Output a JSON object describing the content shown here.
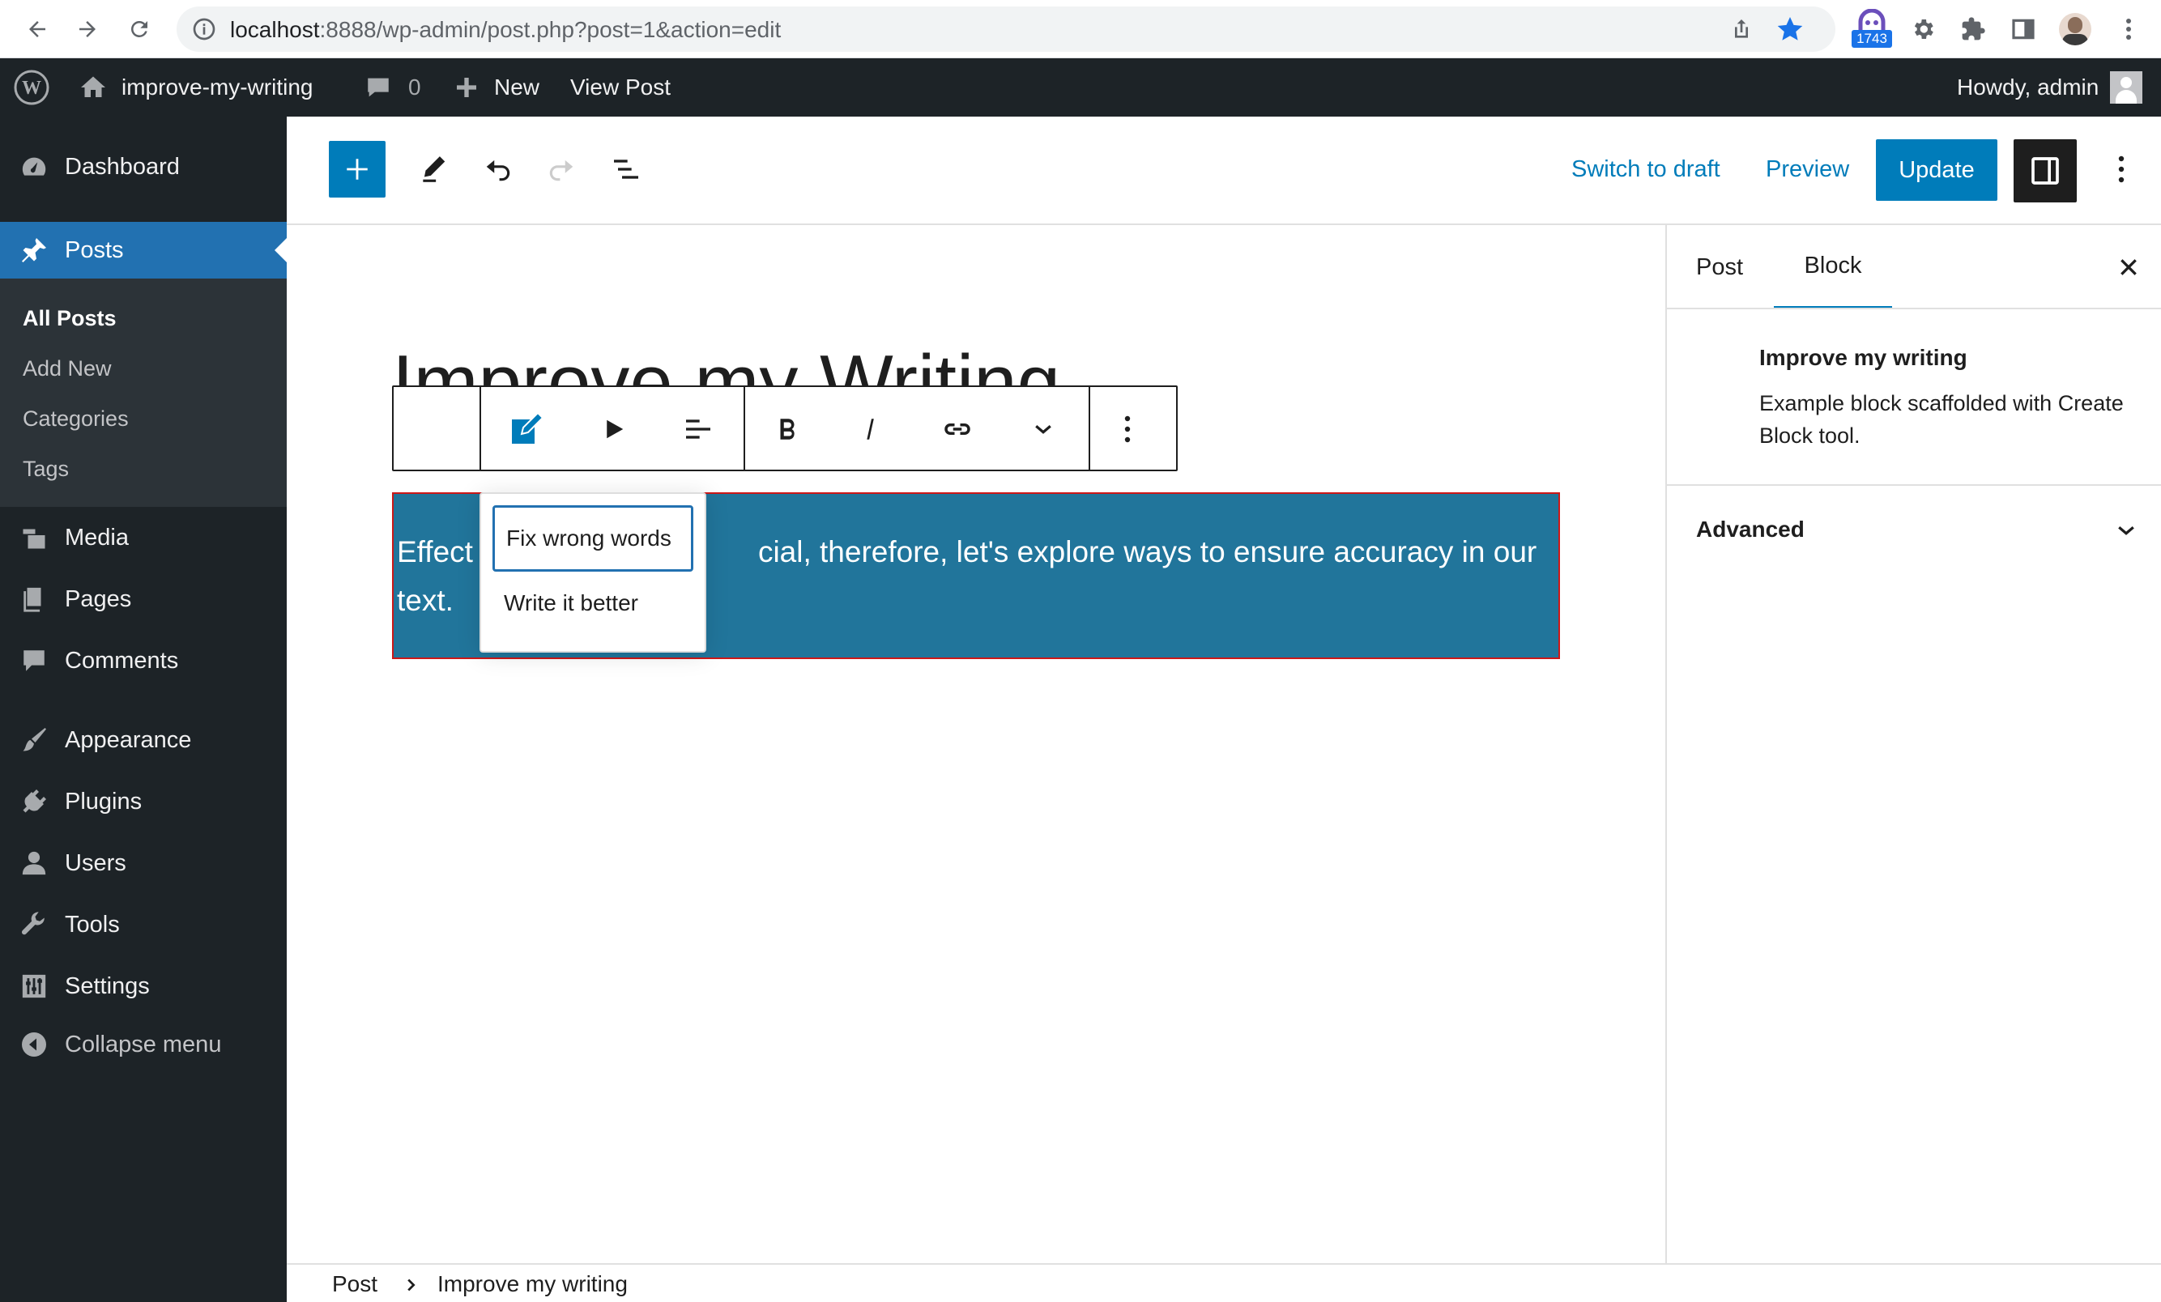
{
  "browser": {
    "url_host": "localhost",
    "url_rest": ":8888/wp-admin/post.php?post=1&action=edit",
    "ext_badge": "1743"
  },
  "admin_bar": {
    "site_name": "improve-my-writing",
    "comments_count": "0",
    "new_label": "New",
    "view_post": "View Post",
    "greeting": "Howdy, admin"
  },
  "sidebar": {
    "dashboard": "Dashboard",
    "posts": "Posts",
    "posts_submenu": [
      "All Posts",
      "Add New",
      "Categories",
      "Tags"
    ],
    "media": "Media",
    "pages": "Pages",
    "comments": "Comments",
    "appearance": "Appearance",
    "plugins": "Plugins",
    "users": "Users",
    "tools": "Tools",
    "settings": "Settings",
    "collapse": "Collapse menu"
  },
  "editor_header": {
    "switch_to_draft": "Switch to draft",
    "preview": "Preview",
    "update": "Update"
  },
  "canvas": {
    "post_title": "Improve my Writing",
    "block_text_start": "Effect",
    "block_text_rest": "cial, therefore, let's explore ways to ensure accuracy in our",
    "block_text_line2": "text.",
    "popover_items": [
      "Fix wrong words",
      "Write it better"
    ]
  },
  "inspector": {
    "tab_post": "Post",
    "tab_block": "Block",
    "block_title": "Improve my writing",
    "block_description": "Example block scaffolded with Create Block tool.",
    "advanced": "Advanced"
  },
  "footer": {
    "crumb_root": "Post",
    "crumb_current": "Improve my writing"
  },
  "colors": {
    "wp_blue": "#007cba",
    "admin_dark": "#1d2327",
    "block_bg": "#21759b",
    "menu_active": "#2271b1"
  }
}
